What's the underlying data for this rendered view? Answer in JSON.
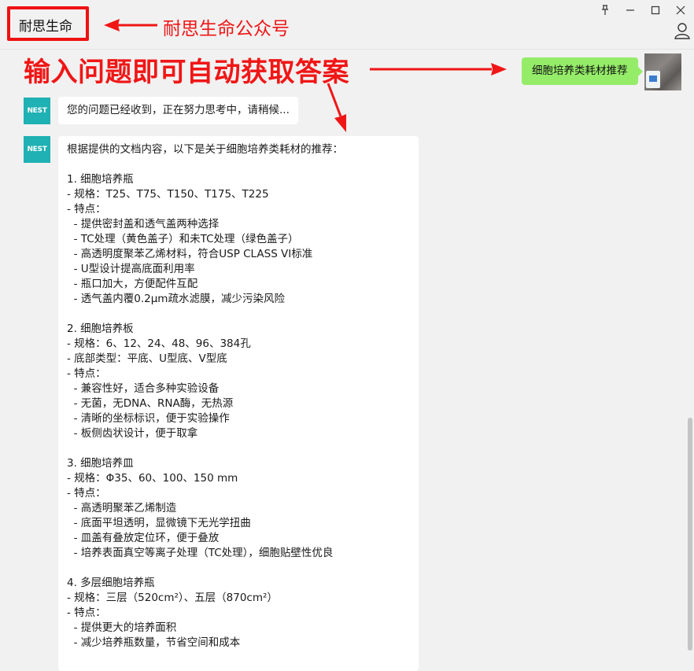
{
  "window": {
    "chat_title": "耐思生命",
    "controls": [
      "pin-icon",
      "minimize-icon",
      "maximize-icon",
      "close-icon"
    ],
    "user_icon": "user-icon"
  },
  "annotations": {
    "title_note": "耐思生命公众号",
    "input_note": "输入问题即可自动获取答案",
    "color": "#f01616"
  },
  "avatars": {
    "bot_label": "NEST",
    "bot_color": "#1fb1b3"
  },
  "messages": {
    "user_query": "细胞培养类耗材推荐",
    "bot_ack": "您的问题已经收到，正在努力思考中，请稍候...",
    "bot_answer_lines": [
      "根据提供的文档内容，以下是关于细胞培养类耗材的推荐：",
      "",
      "1. 细胞培养瓶",
      "- 规格：T25、T75、T150、T175、T225",
      "- 特点：",
      "  - 提供密封盖和透气盖两种选择",
      "  - TC处理（黄色盖子）和未TC处理（绿色盖子）",
      "  - 高透明度聚苯乙烯材料，符合USP CLASS VI标准",
      "  - U型设计提高底面利用率",
      "  - 瓶口加大，方便配件互配",
      "  - 透气盖内覆0.2μm疏水滤膜，减少污染风险",
      "",
      "2. 细胞培养板",
      "- 规格：6、12、24、48、96、384孔",
      "- 底部类型：平底、U型底、V型底",
      "- 特点：",
      "  - 兼容性好，适合多种实验设备",
      "  - 无菌，无DNA、RNA酶，无热源",
      "  - 清晰的坐标标识，便于实验操作",
      "  - 板侧齿状设计，便于取拿",
      "",
      "3. 细胞培养皿",
      "- 规格：Φ35、60、100、150 mm",
      "- 特点：",
      "  - 高透明聚苯乙烯制造",
      "  - 底面平坦透明，显微镜下无光学扭曲",
      "  - 皿盖有叠放定位环，便于叠放",
      "  - 培养表面真空等离子处理（TC处理），细胞贴壁性优良",
      "",
      "4. 多层细胞培养瓶",
      "- 规格：三层（520cm²）、五层（870cm²）",
      "- 特点：",
      "  - 提供更大的培养面积",
      "  - 减少培养瓶数量，节省空间和成本"
    ],
    "green_bubble_color": "#95ec69"
  }
}
